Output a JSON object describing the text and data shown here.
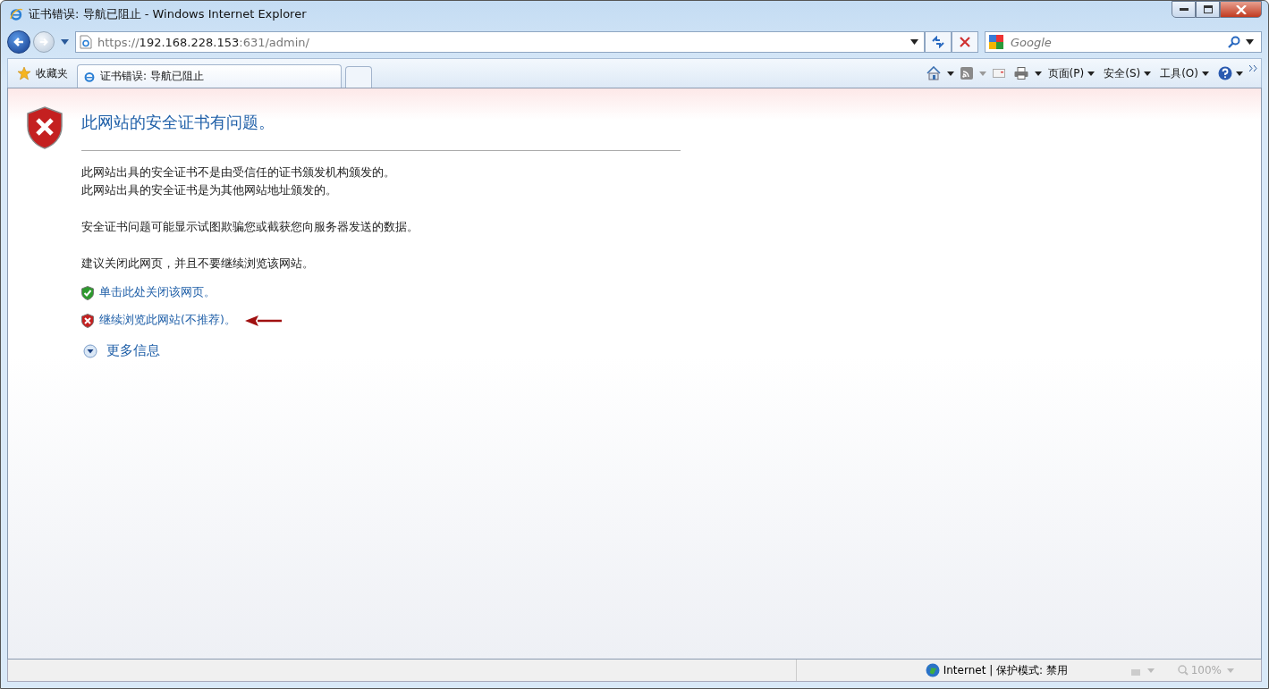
{
  "window": {
    "title": "证书错误: 导航已阻止 - Windows Internet Explorer"
  },
  "address_bar": {
    "scheme": "https://",
    "host": "192.168.228.153",
    "path": ":631/admin/"
  },
  "search": {
    "placeholder": "Google"
  },
  "favorites": {
    "label": "收藏夹"
  },
  "tabs": [
    {
      "label": "证书错误: 导航已阻止",
      "selected": true
    }
  ],
  "command_bar": {
    "menus": [
      "页面(P)",
      "安全(S)",
      "工具(O)"
    ]
  },
  "content": {
    "heading": "此网站的安全证书有问题。",
    "reasons": [
      "此网站出具的安全证书不是由受信任的证书颁发机构颁发的。",
      "此网站出具的安全证书是为其他网站地址颁发的。"
    ],
    "warning": "安全证书问题可能显示试图欺骗您或截获您向服务器发送的数据。",
    "advice": "建议关闭此网页，并且不要继续浏览该网站。",
    "links": [
      {
        "kind": "safe",
        "label": "单击此处关闭该网页。"
      },
      {
        "kind": "unsafe",
        "label": "继续浏览此网站(不推荐)。"
      }
    ],
    "more_info": {
      "label": "更多信息",
      "expanded": false
    }
  },
  "status_bar": {
    "zone": "Internet | 保护模式: 禁用",
    "zoom": "100%"
  }
}
